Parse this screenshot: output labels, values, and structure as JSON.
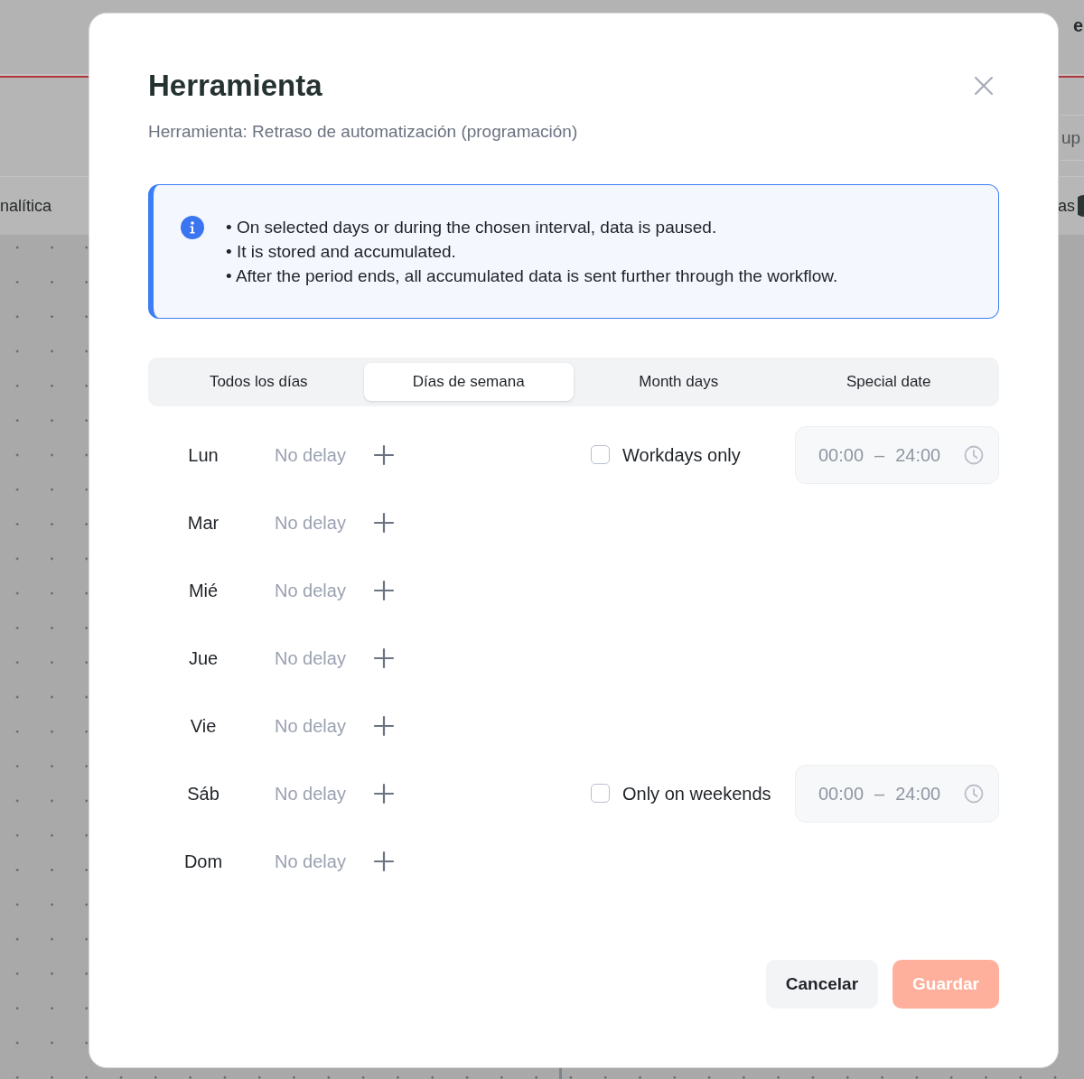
{
  "background": {
    "header_text": "e",
    "toolbar_text": "up",
    "tabs": [
      {
        "label": "nalítica",
        "badge": false
      },
      {
        "label": "as",
        "badge": true
      }
    ]
  },
  "dialog": {
    "title": "Herramienta",
    "subtitle": "Herramienta: Retraso de automatización (programación)"
  },
  "info": {
    "lines": [
      "• On selected days or during the chosen interval, data is paused.",
      "• It is stored and accumulated.",
      "• After the period ends, all accumulated data is sent further through the workflow."
    ]
  },
  "tabs": [
    {
      "label": "Todos los días",
      "selected": false
    },
    {
      "label": "Días de semana",
      "selected": true
    },
    {
      "label": "Month days",
      "selected": false
    },
    {
      "label": "Special date",
      "selected": false
    }
  ],
  "days": [
    {
      "day": "Lun",
      "delay": "No delay",
      "option": {
        "label": "Workdays only",
        "checked": false,
        "time_from": "00:00",
        "time_separator": "–",
        "time_to": "24:00",
        "time_disabled": true
      }
    },
    {
      "day": "Mar",
      "delay": "No delay"
    },
    {
      "day": "Mié",
      "delay": "No delay"
    },
    {
      "day": "Jue",
      "delay": "No delay"
    },
    {
      "day": "Vie",
      "delay": "No delay"
    },
    {
      "day": "Sáb",
      "delay": "No delay",
      "option": {
        "label": "Only on weekends",
        "checked": false,
        "time_from": "00:00",
        "time_separator": "–",
        "time_to": "24:00",
        "time_disabled": true
      }
    },
    {
      "day": "Dom",
      "delay": "No delay"
    }
  ],
  "buttons": [
    {
      "label": "Cancelar",
      "kind": "secondary",
      "disabled": false
    },
    {
      "label": "Guardar",
      "kind": "primary",
      "disabled": true
    }
  ]
}
